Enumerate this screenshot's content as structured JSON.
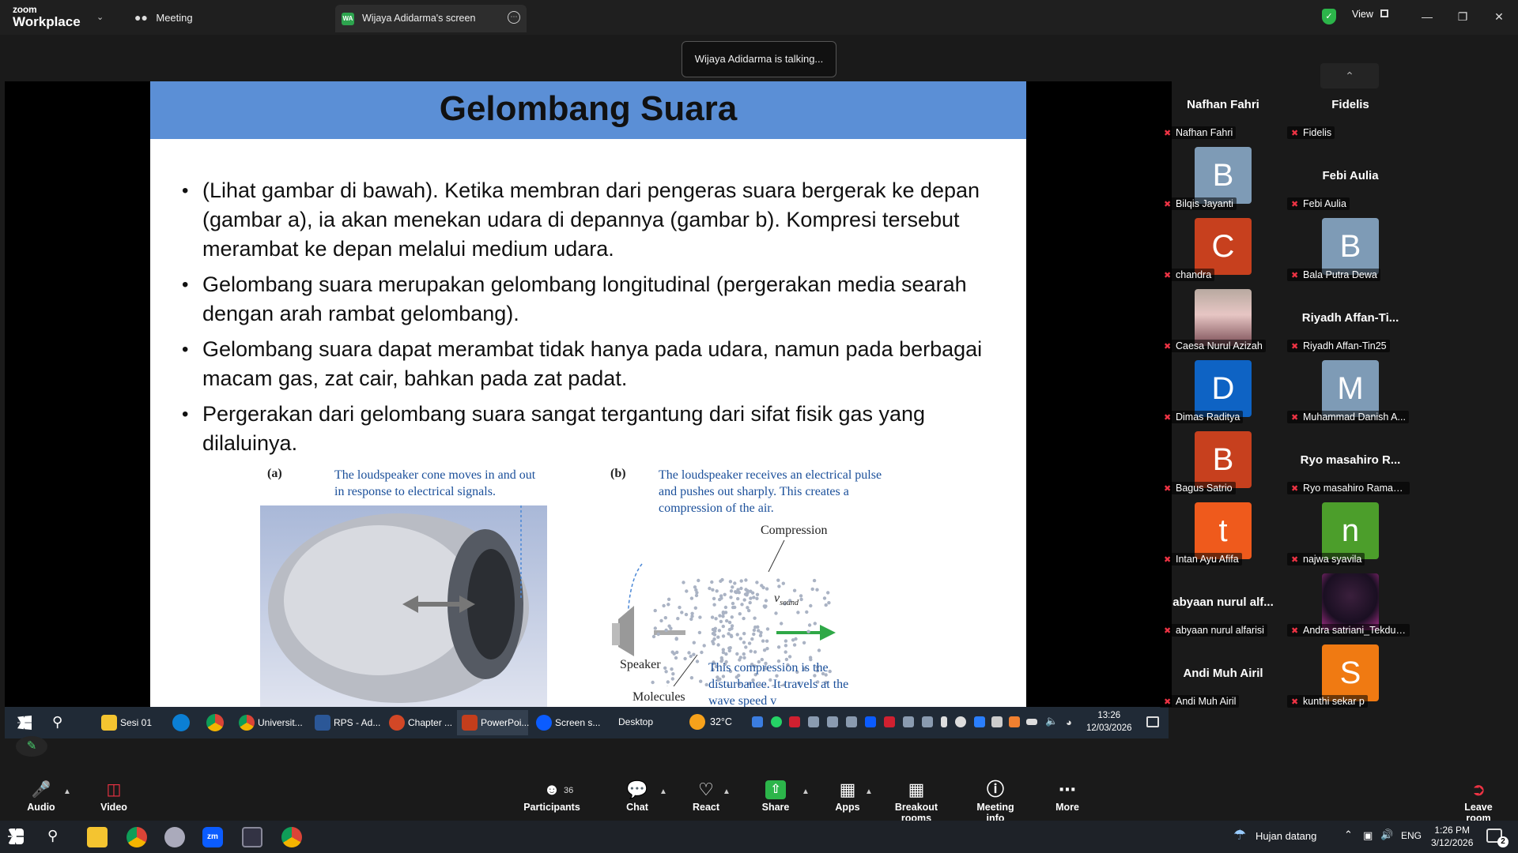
{
  "window": {
    "app_brand_line1": "zoom",
    "app_brand_line2": "Workplace",
    "meeting_tab": "Meeting",
    "share_tab": "Wijaya Adidarma's screen",
    "share_badge": "WA",
    "view_label": "View"
  },
  "toast": "Wijaya Adidarma is talking...",
  "slide": {
    "title": "Gelombang Suara",
    "bullets": [
      "(Lihat gambar di bawah). Ketika membran dari pengeras suara bergerak ke depan (gambar a), ia akan menekan udara di depannya (gambar b). Kompresi tersebut merambat ke depan melalui medium udara.",
      "Gelombang suara merupakan gelombang longitudinal (pergerakan media searah dengan arah rambat gelombang).",
      "Gelombang suara dapat merambat tidak hanya pada udara, namun pada berbagai macam gas, zat cair, bahkan pada zat padat.",
      "Pergerakan dari gelombang suara sangat tergantung dari sifat fisik gas yang dilaluinya."
    ],
    "figure_a_label": "(a)",
    "figure_a_caption": "The loudspeaker cone moves in and out in response to electrical signals.",
    "figure_b_label": "(b)",
    "figure_b_caption": "The loudspeaker receives an electrical pulse and pushes out sharply. This creates a compression of the air.",
    "compression_label": "Compression",
    "speaker_label": "Speaker",
    "molecules_label": "Molecules",
    "vsound_label": "v",
    "vsound_sub": "sound",
    "bottom_caption": "This compression is the disturbance. It travels at the wave speed v"
  },
  "inner_taskbar": {
    "items": [
      "Sesi 01",
      "Universit...",
      "RPS - Ad...",
      "Chapter ...",
      "PowerPoi...",
      "Screen s..."
    ],
    "desktop": "Desktop",
    "weather": "32°C",
    "time": "13:26",
    "date": "12/03/2026"
  },
  "participants": [
    {
      "name": "Nafhan Fahri",
      "label": "Nafhan Fahri",
      "avatar": "",
      "color": ""
    },
    {
      "name": "Fidelis",
      "label": "Fidelis",
      "avatar": "",
      "color": ""
    },
    {
      "name": "",
      "label": "Bilqis Jayanti",
      "avatar": "B",
      "color": "#7e9bb6"
    },
    {
      "name": "Febi Aulia",
      "label": "Febi Aulia",
      "avatar": "",
      "color": ""
    },
    {
      "name": "",
      "label": "chandra",
      "avatar": "C",
      "color": "#c7401e"
    },
    {
      "name": "",
      "label": "Bala Putra Dewa",
      "avatar": "B",
      "color": "#7e9bb6"
    },
    {
      "name": "",
      "label": "Caesa Nurul Azizah",
      "avatar": "",
      "color": "photo"
    },
    {
      "name": "Riyadh Affan-Ti...",
      "label": "Riyadh Affan-Tin25",
      "avatar": "",
      "color": ""
    },
    {
      "name": "",
      "label": "Dimas Raditya",
      "avatar": "D",
      "color": "#0e63c4"
    },
    {
      "name": "",
      "label": "Muhammad Danish A...",
      "avatar": "M",
      "color": "#7e9bb6"
    },
    {
      "name": "",
      "label": "Bagus Satrio",
      "avatar": "B",
      "color": "#c7401e"
    },
    {
      "name": "Ryo masahiro R...",
      "label": "Ryo masahiro Ramad...",
      "avatar": "",
      "color": ""
    },
    {
      "name": "",
      "label": "Intan Ayu Afifa",
      "avatar": "t",
      "color": "#ef5a1c"
    },
    {
      "name": "",
      "label": "najwa syavila",
      "avatar": "n",
      "color": "#4c9e2b"
    },
    {
      "name": "abyaan nurul alf...",
      "label": "abyaan nurul alfarisi",
      "avatar": "",
      "color": ""
    },
    {
      "name": "",
      "label": "Andra satriani_Tekdus...",
      "avatar": "",
      "color": "photo2"
    },
    {
      "name": "Andi Muh Airil",
      "label": "Andi Muh Airil",
      "avatar": "",
      "color": ""
    },
    {
      "name": "",
      "label": "kunthi sekar p",
      "avatar": "S",
      "color": "#f07a12"
    }
  ],
  "toolbar": {
    "audio": "Audio",
    "video": "Video",
    "participants": "Participants",
    "participants_count": "36",
    "chat": "Chat",
    "react": "React",
    "share": "Share",
    "apps": "Apps",
    "breakout": "Breakout rooms",
    "meeting_info": "Meeting info",
    "more": "More",
    "leave": "Leave room"
  },
  "windows_taskbar": {
    "weather_text": "Hujan datang",
    "lang": "ENG",
    "time": "1:26 PM",
    "date": "3/12/2026",
    "notif_count": "2"
  }
}
